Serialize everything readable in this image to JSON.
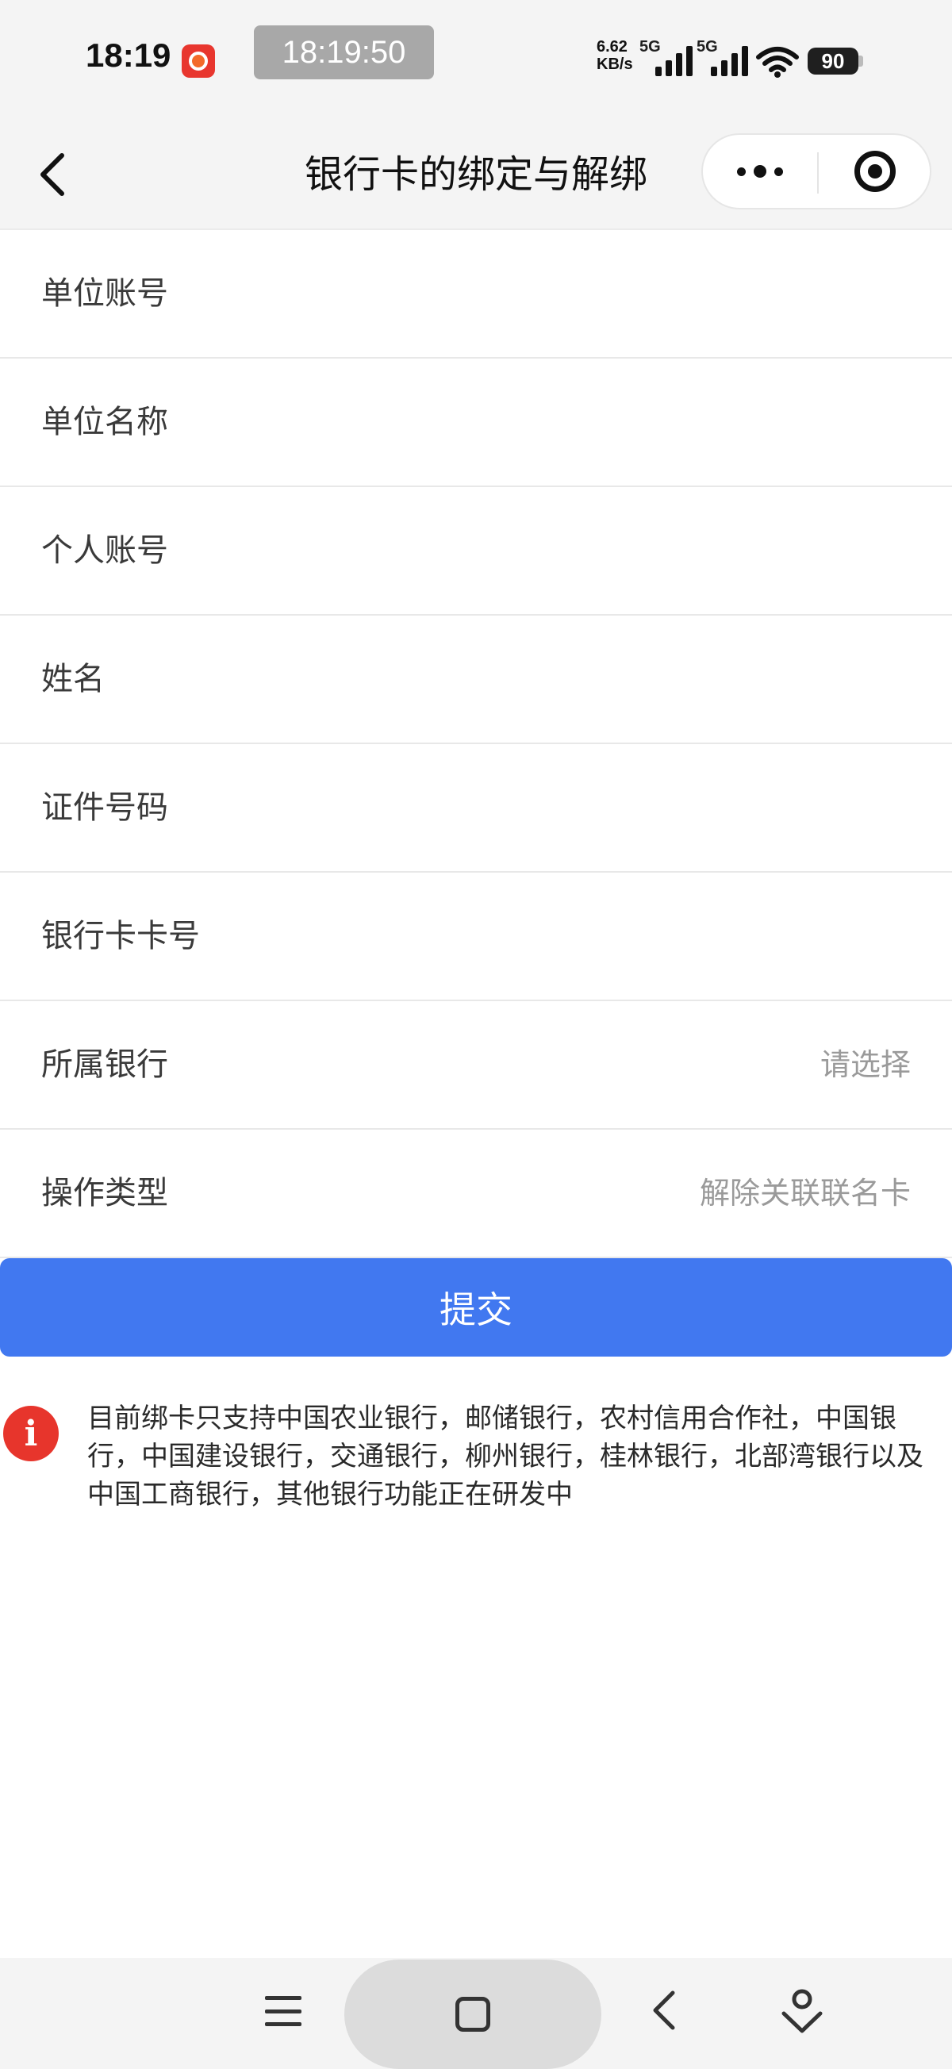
{
  "status_bar": {
    "time": "18:19",
    "pill_time": "18:19:50",
    "net_speed_value": "6.62",
    "net_speed_unit": "KB/s",
    "net_type_1": "5G",
    "net_type_2": "5G",
    "battery": "90"
  },
  "nav": {
    "title": "银行卡的绑定与解绑"
  },
  "form": {
    "rows": [
      {
        "label": "单位账号",
        "value": ""
      },
      {
        "label": "单位名称",
        "value": ""
      },
      {
        "label": "个人账号",
        "value": ""
      },
      {
        "label": "姓名",
        "value": ""
      },
      {
        "label": "证件号码",
        "value": ""
      },
      {
        "label": "银行卡卡号",
        "value": ""
      },
      {
        "label": "所属银行",
        "value": "请选择"
      },
      {
        "label": "操作类型",
        "value": "解除关联联名卡"
      }
    ]
  },
  "submit": {
    "label": "提交"
  },
  "notice": {
    "icon": "i",
    "text": "目前绑卡只支持中国农业银行，邮储银行，农村信用合作社，中国银行，中国建设银行，交通银行，柳州银行，桂林银行，北部湾银行以及中国工商银行，其他银行功能正在研发中"
  },
  "colors": {
    "primary": "#4178f0",
    "alert": "#e7352c",
    "background": "#f4f4f4"
  }
}
